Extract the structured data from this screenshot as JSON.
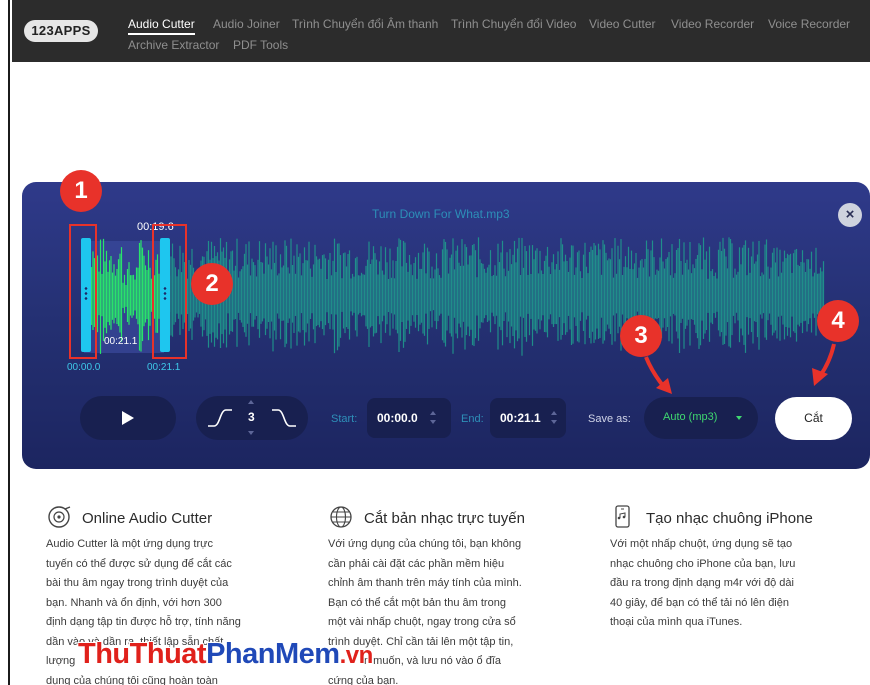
{
  "nav": {
    "logo": "123APPS",
    "links": [
      "Audio Cutter",
      "Audio Joiner",
      "Trình Chuyển đổi Âm thanh",
      "Trình Chuyển đổi Video",
      "Video Cutter",
      "Video Recorder",
      "Voice Recorder",
      "Archive Extractor",
      "PDF Tools"
    ],
    "active": "Audio Cutter"
  },
  "editor": {
    "file_title": "Turn Down For What.mp3",
    "close_icon": "×",
    "selection_time": "00:19.6",
    "inner_time": "00:21.1",
    "start_marker_time": "00:00.0",
    "end_marker_time": "00:21.1",
    "fade_value": "3",
    "start_label": "Start:",
    "start_value": "00:00.0",
    "end_label": "End:",
    "end_value": "00:21.1",
    "save_as_label": "Save as:",
    "save_format": "Auto (mp3)",
    "cut_label": "Cắt"
  },
  "markers": [
    "1",
    "2",
    "3",
    "4"
  ],
  "features": [
    {
      "icon": "disc-icon",
      "title": "Online Audio Cutter",
      "lines": [
        "Audio Cutter là một ứng dụng trực",
        "tuyến có thể được sử dụng để cắt các",
        "bài thu âm ngay trong trình duyệt của",
        "bạn. Nhanh và ổn định, với hơn 300",
        "định dạng tập tin được hỗ trợ, tính năng",
        "dần vào và dần ra, thiết lập sẵn chất",
        "lượng",
        "dụng của chúng tôi cũng hoàn toàn"
      ]
    },
    {
      "icon": "globe-icon",
      "title": "Cắt bản nhạc trực tuyến",
      "lines": [
        "Với ứng dụng của chúng tôi, bạn không",
        "cần phải cài đặt các phần mềm hiệu",
        "chỉnh âm thanh trên máy tính của mình.",
        "Bạn có thể cắt một bản thu âm trong",
        "một vài nhấp chuột, ngay trong cửa sổ",
        "trình duyệt. Chỉ cần tải lên một tập tin,",
        "n muốn, và lưu nó vào ổ đĩa",
        "cứng của bạn."
      ]
    },
    {
      "icon": "phone-icon",
      "title": "Tạo nhạc chuông iPhone",
      "lines": [
        "Với một nhấp chuột, ứng dụng sẽ tạo",
        "nhạc chuông cho iPhone của bạn, lưu",
        "đầu ra trong định dạng m4r với độ dài",
        "40 giây, để bạn có thể tải nó lên điện",
        "thoại của mình qua iTunes."
      ]
    }
  ],
  "watermark": {
    "part1": "ThuThuat",
    "part2": "PhanMem",
    "part3": ".vn"
  },
  "colors": {
    "nav_bg": "#2c2c2c",
    "editor_bg": "#243072",
    "wave_selected": "#29e36b",
    "wave_unselected": "#1f9e8e",
    "handle": "#1ec6ef",
    "marker_red": "#e8322a",
    "save_green": "#3fd870"
  }
}
